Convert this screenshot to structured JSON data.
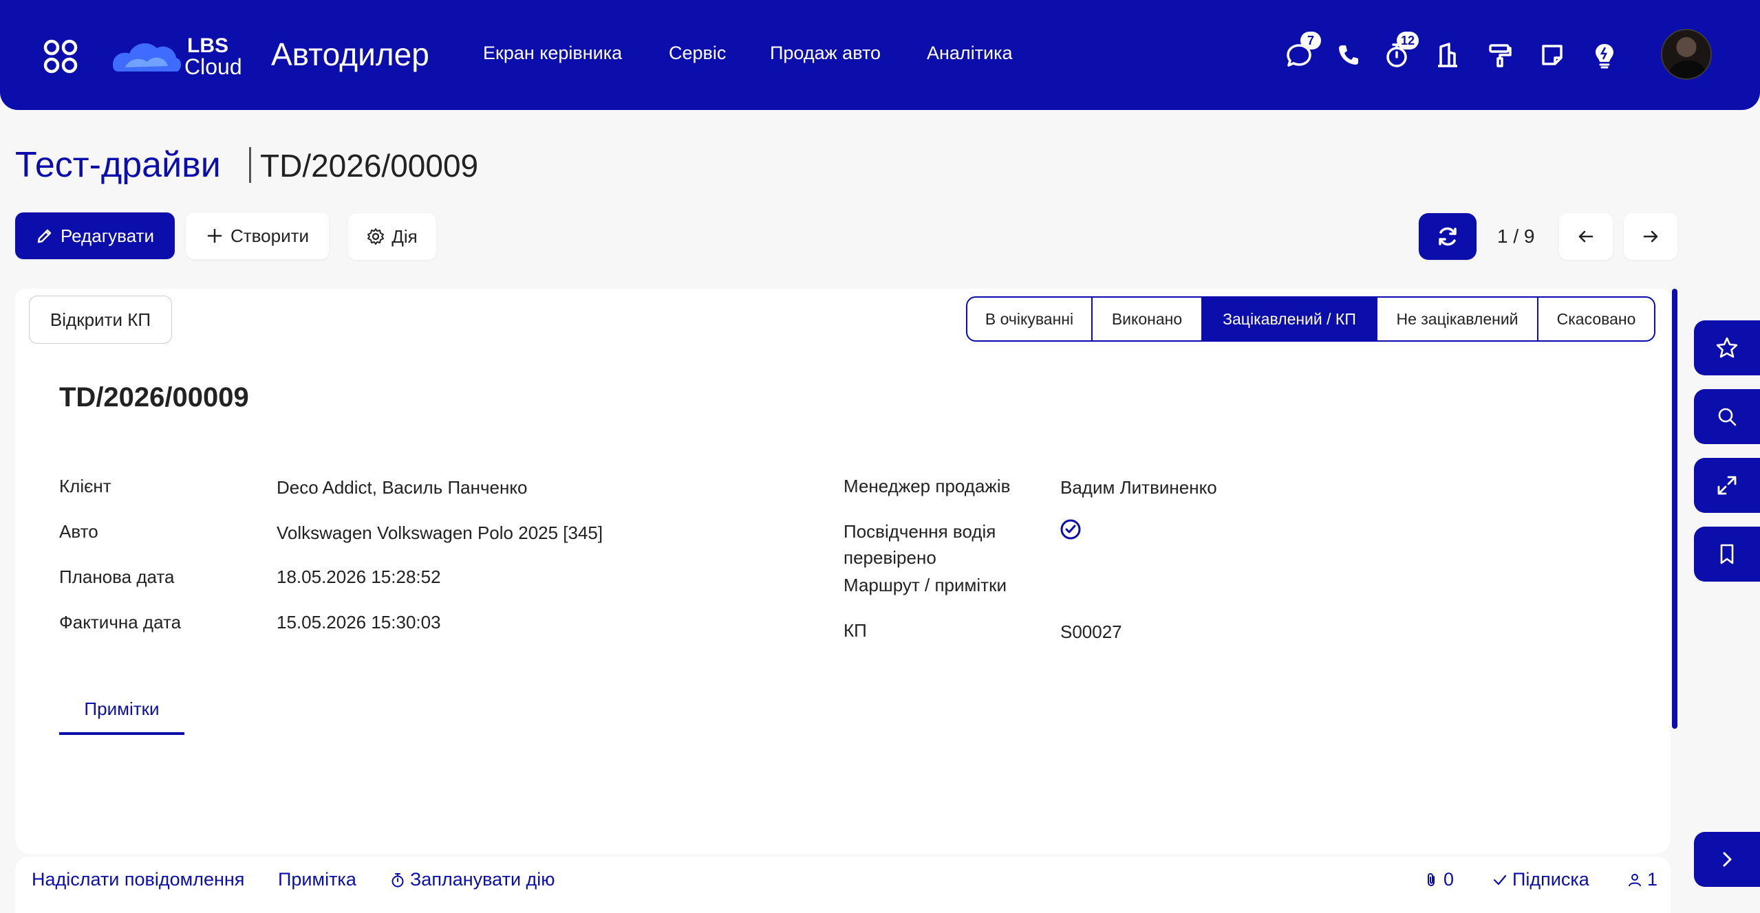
{
  "app": {
    "title": "Автодилер",
    "logo_text_top": "LBS",
    "logo_text_bottom": "Cloud"
  },
  "nav": [
    {
      "label": "Екран керівника"
    },
    {
      "label": "Сервіс"
    },
    {
      "label": "Продаж авто"
    },
    {
      "label": "Аналітика"
    }
  ],
  "systray": {
    "messages_badge": "7",
    "activities_badge": "12",
    "icons": [
      "chat-icon",
      "phone-icon",
      "timer-icon",
      "building-icon",
      "paint-roller-icon",
      "note-icon",
      "lightbulb-icon"
    ]
  },
  "breadcrumb": {
    "parent": "Тест-драйви",
    "current": "TD/2026/00009"
  },
  "toolbar": {
    "edit_label": "Редагувати",
    "create_label": "Створити",
    "action_label": "Дія",
    "pager": "1 / 9"
  },
  "statusbar": {
    "open_kp_label": "Відкрити КП",
    "stages": [
      {
        "label": "В очікуванні",
        "active": false
      },
      {
        "label": "Виконано",
        "active": false
      },
      {
        "label": "Зацікавлений / КП",
        "active": true
      },
      {
        "label": "Не зацікавлений",
        "active": false
      },
      {
        "label": "Скасовано",
        "active": false
      }
    ]
  },
  "record": {
    "title": "TD/2026/00009",
    "left": [
      {
        "label": "Клієнт",
        "value": "Deco Addict, Василь Панченко"
      },
      {
        "label": "Авто",
        "value": "Volkswagen Volkswagen Polo 2025 [345]"
      },
      {
        "label": "Планова дата",
        "value": "18.05.2026 15:28:52"
      },
      {
        "label": "Фактична дата",
        "value": "15.05.2026 15:30:03"
      }
    ],
    "right": {
      "manager_label": "Менеджер продажів",
      "manager_value": "Вадим Литвиненко",
      "license_label_1": "Посвідчення водія",
      "license_label_2": "перевірено",
      "license_checked": true,
      "route_label": "Маршрут / примітки",
      "route_value": "",
      "kp_label": "КП",
      "kp_value": "S00027"
    },
    "tab_notes": "Примітки"
  },
  "chatter": {
    "send_message": "Надіслати повідомлення",
    "note": "Примітка",
    "schedule": "Запланувати дію",
    "attachments": "0",
    "subscribe": "Підписка",
    "followers": "1"
  },
  "colors": {
    "brand": "#0b0eab",
    "background": "#f7f7f7"
  }
}
